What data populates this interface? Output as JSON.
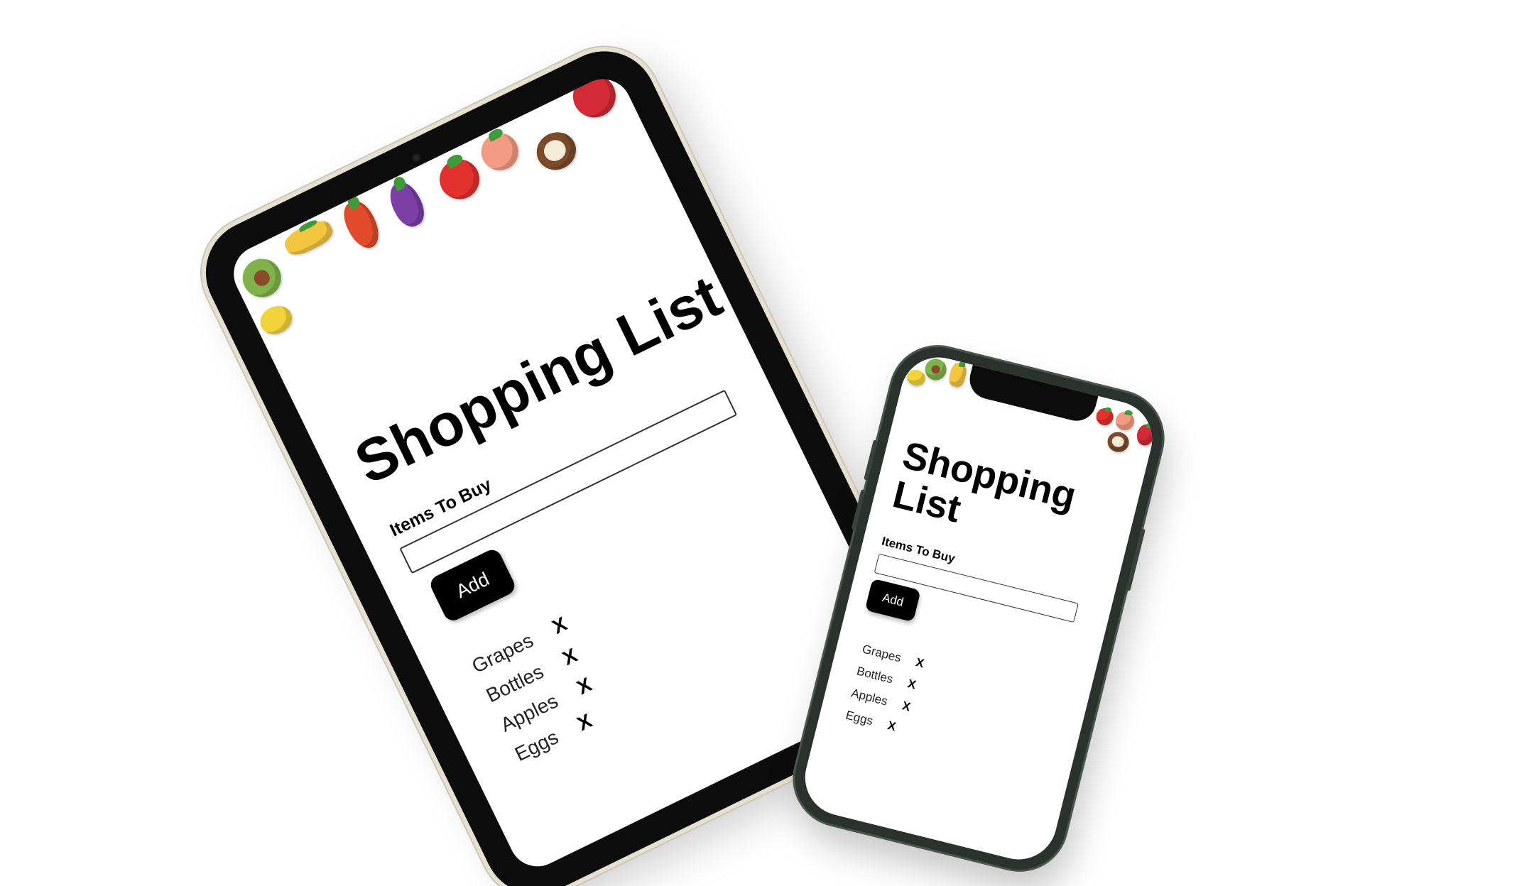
{
  "app": {
    "title": "Shopping List",
    "input_label": "Items To Buy",
    "input_value": "",
    "add_button": "Add",
    "remove_glyph": "X",
    "items": [
      "Grapes",
      "Bottles",
      "Apples",
      "Eggs"
    ]
  },
  "produce_icons": [
    {
      "name": "avocado-icon",
      "color": "#7fb24a"
    },
    {
      "name": "lemon-icon",
      "color": "#f2d43a"
    },
    {
      "name": "corn-icon",
      "color": "#f3c640"
    },
    {
      "name": "pepper-icon",
      "color": "#e14a2b"
    },
    {
      "name": "eggplant-icon",
      "color": "#7b3fa6"
    },
    {
      "name": "apple-icon",
      "color": "#e2302c"
    },
    {
      "name": "peach-icon",
      "color": "#f29a82"
    },
    {
      "name": "coconut-icon",
      "color": "#7a4a2a"
    },
    {
      "name": "pomegranate-icon",
      "color": "#d22a36"
    }
  ],
  "colors": {
    "button_bg": "#000000",
    "button_text": "#ffffff",
    "tablet_bezel": "#0c0c0c",
    "phone_frame": "#2b322e"
  }
}
